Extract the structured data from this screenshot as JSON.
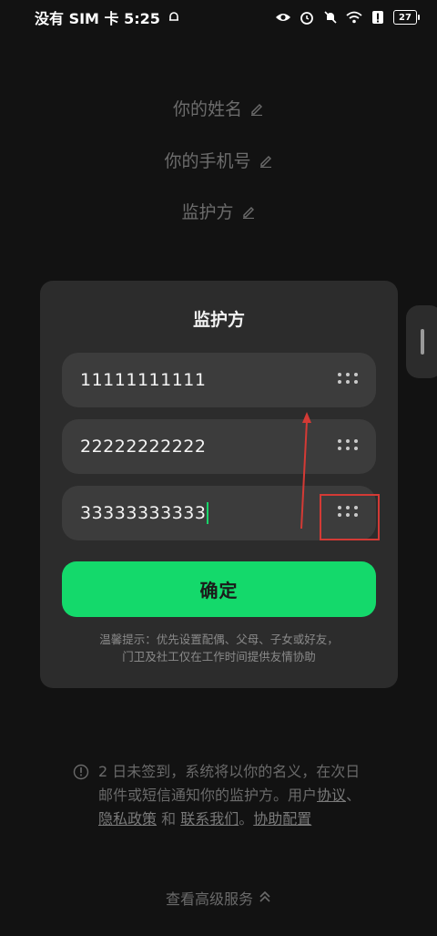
{
  "status_bar": {
    "carrier_time": "没有 SIM 卡 5:25",
    "battery": "27",
    "icons": [
      "eye-icon",
      "alarm-icon",
      "mute-icon",
      "wifi-icon",
      "alert-icon",
      "battery-icon"
    ]
  },
  "form": {
    "name_label": "你的姓名",
    "phone_label": "你的手机号",
    "guardian_label": "监护方"
  },
  "dialog": {
    "title": "监护方",
    "fields": [
      {
        "value": "11111111111"
      },
      {
        "value": "22222222222"
      },
      {
        "value": "33333333333"
      }
    ],
    "confirm_label": "确定",
    "tip_line1": "温馨提示：优先设置配偶、父母、子女或好友，",
    "tip_line2": "门卫及社工仅在工作时间提供友情协助"
  },
  "notice": {
    "text_part1": "2 日未签到，系统将以你的名义，在次日邮件或短信通知你的监护方。用户",
    "link_agreement": "协议",
    "sep1": "、",
    "link_privacy": "隐私政策",
    "sep2": " 和 ",
    "link_contact": "联系我们",
    "sep3": "。",
    "link_assist": "协助配置"
  },
  "footer": {
    "advanced_label": "查看高级服务"
  },
  "colors": {
    "accent": "#14d96b",
    "annotation": "#d33a35"
  }
}
